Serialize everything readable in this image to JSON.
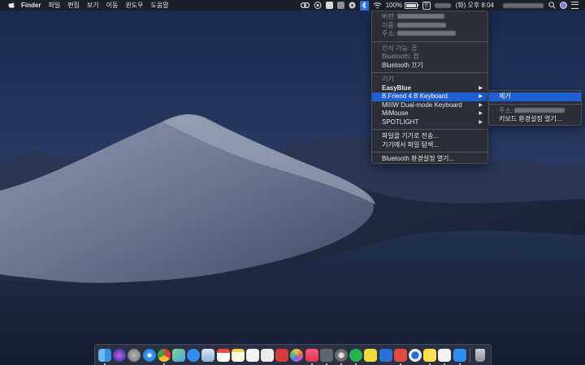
{
  "menubar": {
    "app_name": "Finder",
    "items": [
      "파일",
      "편집",
      "보기",
      "이동",
      "윈도우",
      "도움말"
    ],
    "battery_percent": "100%",
    "battery_level": 1.0,
    "input_method_label": "한",
    "clock": "(화) 오후 8:04",
    "status_icons": [
      "cc-icon",
      "eye-icon",
      "window-icon",
      "screenshot-icon",
      "bluetooth-icon",
      "wifi-icon",
      "input-method-icon",
      "user-avatar-icon",
      "notification-list-icon"
    ]
  },
  "bluetooth_menu": {
    "info": {
      "version_label": "버전:",
      "name_label": "이름:",
      "address_label": "주소:"
    },
    "discoverable": "인식 가능: 끔",
    "status": "Bluetooth: 켬",
    "toggle": "Bluetooth 끄기",
    "devices_header": "기기",
    "devices": [
      {
        "name": "EasyBlue",
        "connected": true
      },
      {
        "name": "B.Friend 4 B Keyboard",
        "connected": false
      },
      {
        "name": "MIIIW Dual-mode Keyboard",
        "connected": false
      },
      {
        "name": "MiMouse",
        "connected": false
      },
      {
        "name": "SPOTLIGHT",
        "connected": false
      }
    ],
    "send_file": "파일을 기기로 전송...",
    "browse_files": "기기에서 파일 탐색...",
    "open_prefs": "Bluetooth 환경설정 열기..."
  },
  "device_submenu": {
    "remove": "제거",
    "address_label": "주소:",
    "keyboard_prefs": "키보드 환경설정 열기..."
  },
  "dock": {
    "apps": [
      "finder-icon",
      "siri-icon",
      "launchpad-icon",
      "safari-icon",
      "chrome-icon",
      "maps-icon",
      "app-store-icon",
      "preview-icon",
      "calendar-icon",
      "notes-icon",
      "reminders-icon",
      "textedit-icon",
      "photo-booth-icon",
      "photos-icon",
      "music-icon",
      "facetime-icon",
      "system-preferences-icon",
      "evernote-icon",
      "sticky-icon",
      "app-icon-red",
      "app-icon-blue",
      "app-icon-orange",
      "kakaotalk-icon",
      "icloud-icon",
      "teamviewer-icon"
    ],
    "trash": "trash-icon"
  },
  "colors": {
    "accent": "#1f5fd6",
    "menubar_bg": "#1c1e26",
    "menu_bg": "#2c2e36"
  }
}
